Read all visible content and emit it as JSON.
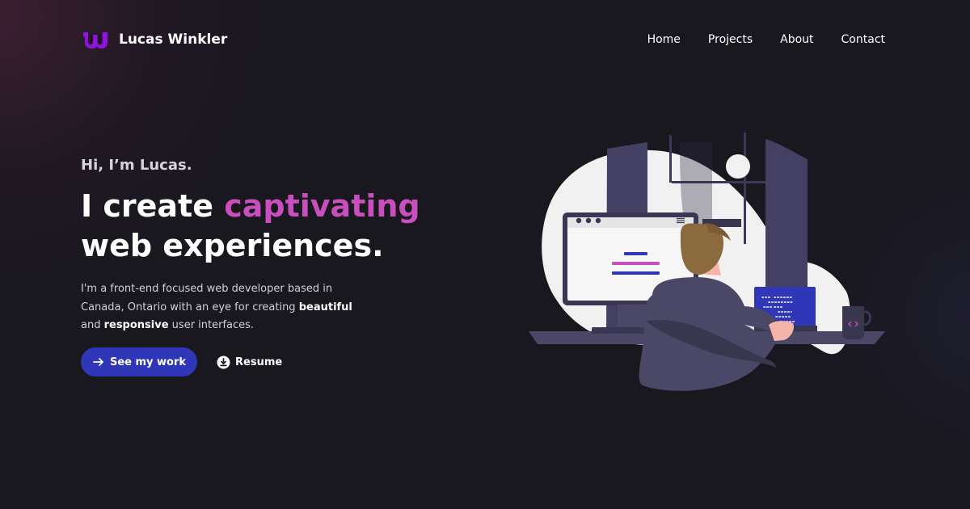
{
  "site": {
    "brand_name": "Lucas Winkler",
    "accent_color": "#c84fbd",
    "button_color": "#3036b8",
    "background_color": "#19181f"
  },
  "navigation": {
    "items": [
      {
        "label": "Home"
      },
      {
        "label": "Projects"
      },
      {
        "label": "About"
      },
      {
        "label": "Contact"
      }
    ]
  },
  "hero": {
    "greeting": "Hi, I’m Lucas.",
    "headline_prefix": "I create ",
    "headline_accent": "captivating",
    "headline_suffix": "web experiences.",
    "intro_prefix": "I'm a front-end focused web developer based in Canada, Ontario with an eye for creating ",
    "intro_strong_1": "beautiful",
    "intro_middle": " and ",
    "intro_strong_2": "responsive",
    "intro_suffix": " user interfaces."
  },
  "actions": {
    "primary_label": "See my work",
    "secondary_label": "Resume"
  },
  "icons": {
    "brand": "lw-monogram-logo",
    "primary": "arrow-right-icon",
    "secondary": "download-icon"
  }
}
